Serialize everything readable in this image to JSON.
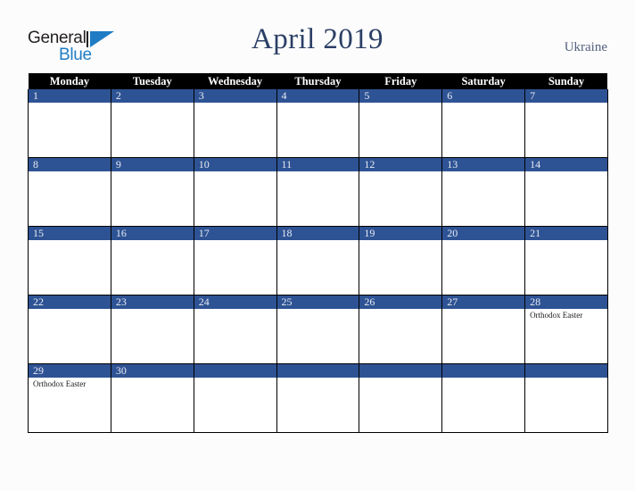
{
  "brand": {
    "name_part1": "General",
    "name_part2": "Blue",
    "mark_icon": "triangle-flag-icon",
    "color_dark": "#231f20",
    "color_blue": "#1f7cc4"
  },
  "header": {
    "title": "April 2019",
    "country": "Ukraine",
    "title_color": "#2b3f66",
    "country_color": "#53607f"
  },
  "calendar": {
    "month": "April",
    "year": "2019",
    "accent_color": "#2e5394",
    "header_bg": "#000000",
    "weekday_headers": [
      "Monday",
      "Tuesday",
      "Wednesday",
      "Thursday",
      "Friday",
      "Saturday",
      "Sunday"
    ],
    "weeks": [
      [
        {
          "day": "1",
          "events": []
        },
        {
          "day": "2",
          "events": []
        },
        {
          "day": "3",
          "events": []
        },
        {
          "day": "4",
          "events": []
        },
        {
          "day": "5",
          "events": []
        },
        {
          "day": "6",
          "events": []
        },
        {
          "day": "7",
          "events": []
        }
      ],
      [
        {
          "day": "8",
          "events": []
        },
        {
          "day": "9",
          "events": []
        },
        {
          "day": "10",
          "events": []
        },
        {
          "day": "11",
          "events": []
        },
        {
          "day": "12",
          "events": []
        },
        {
          "day": "13",
          "events": []
        },
        {
          "day": "14",
          "events": []
        }
      ],
      [
        {
          "day": "15",
          "events": []
        },
        {
          "day": "16",
          "events": []
        },
        {
          "day": "17",
          "events": []
        },
        {
          "day": "18",
          "events": []
        },
        {
          "day": "19",
          "events": []
        },
        {
          "day": "20",
          "events": []
        },
        {
          "day": "21",
          "events": []
        }
      ],
      [
        {
          "day": "22",
          "events": []
        },
        {
          "day": "23",
          "events": []
        },
        {
          "day": "24",
          "events": []
        },
        {
          "day": "25",
          "events": []
        },
        {
          "day": "26",
          "events": []
        },
        {
          "day": "27",
          "events": []
        },
        {
          "day": "28",
          "events": [
            "Orthodox Easter"
          ]
        }
      ],
      [
        {
          "day": "29",
          "events": [
            "Orthodox Easter"
          ]
        },
        {
          "day": "30",
          "events": []
        },
        {
          "day": "",
          "events": []
        },
        {
          "day": "",
          "events": []
        },
        {
          "day": "",
          "events": []
        },
        {
          "day": "",
          "events": []
        },
        {
          "day": "",
          "events": []
        }
      ]
    ]
  }
}
